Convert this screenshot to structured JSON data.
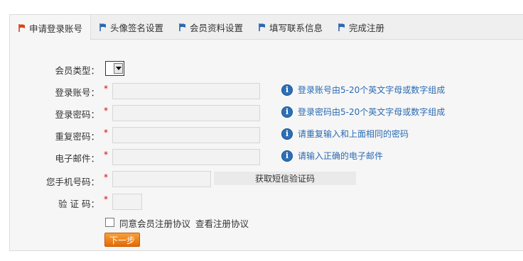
{
  "tabs": [
    {
      "label": "申请登录账号",
      "active": true
    },
    {
      "label": "头像签名设置",
      "active": false
    },
    {
      "label": "会员资料设置",
      "active": false
    },
    {
      "label": "填写联系信息",
      "active": false
    },
    {
      "label": "完成注册",
      "active": false
    }
  ],
  "colors": {
    "active_flag": "#d9461c",
    "inactive_flag": "#2b66b0",
    "hint_text": "#2a6bb3",
    "required": "#dd0000",
    "next_button": "#f08a1a"
  },
  "form": {
    "member_type": {
      "label": "会员类型：",
      "value": ""
    },
    "account": {
      "label": "登录账号：",
      "required": "*",
      "value": "",
      "hint": "登录账号由5-20个英文字母或数字组成"
    },
    "password": {
      "label": "登录密码：",
      "required": "*",
      "value": "",
      "hint": "登录密码由5-20个英文字母或数字组成"
    },
    "repeat_password": {
      "label": "重复密码：",
      "required": "*",
      "value": "",
      "hint": "请重复输入和上面相同的密码"
    },
    "email": {
      "label": "电子邮件：",
      "required": "*",
      "value": "",
      "hint": "请输入正确的电子邮件"
    },
    "phone": {
      "label": "您手机号码：",
      "required": "*",
      "value": "",
      "sms_button": "获取短信验证码"
    },
    "captcha": {
      "label": "验 证 码：",
      "required": "*",
      "value": ""
    },
    "agree_text": "同意会员注册协议",
    "view_agreement": "查看注册协议",
    "next_button": "下一步"
  }
}
